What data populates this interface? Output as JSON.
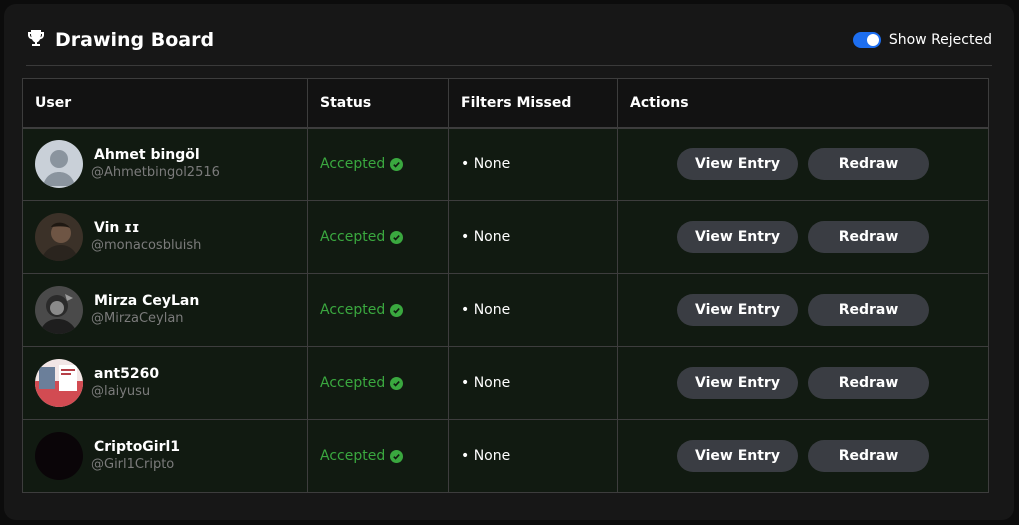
{
  "header": {
    "title": "Drawing Board",
    "title_icon": "trophy-icon",
    "toggle_label": "Show Rejected",
    "toggle_on": true
  },
  "table": {
    "columns": [
      "User",
      "Status",
      "Filters Missed",
      "Actions"
    ],
    "rows": [
      {
        "name": "Ahmet bingöl",
        "handle": "@Ahmetbingol2516",
        "status": "Accepted",
        "filters": "• None",
        "view_label": "View Entry",
        "redraw_label": "Redraw",
        "avatar": "default-avatar"
      },
      {
        "name": "Vin ɪɪ",
        "handle": "@monacosbluish",
        "status": "Accepted",
        "filters": "• None",
        "view_label": "View Entry",
        "redraw_label": "Redraw",
        "avatar": "photo-avatar"
      },
      {
        "name": "Mirza CeyLan",
        "handle": "@MirzaCeylan",
        "status": "Accepted",
        "filters": "• None",
        "view_label": "View Entry",
        "redraw_label": "Redraw",
        "avatar": "photo-avatar"
      },
      {
        "name": "ant5260",
        "handle": "@laiyusu",
        "status": "Accepted",
        "filters": "• None",
        "view_label": "View Entry",
        "redraw_label": "Redraw",
        "avatar": "photo-avatar"
      },
      {
        "name": "CriptoGirl1",
        "handle": "@Girl1Cripto",
        "status": "Accepted",
        "filters": "• None",
        "view_label": "View Entry",
        "redraw_label": "Redraw",
        "avatar": "dark-avatar"
      }
    ]
  },
  "colors": {
    "accent": "#1d6ef0",
    "accepted": "#3aa83f",
    "row_bg": "#111a11",
    "button_bg": "#3a3d43"
  }
}
